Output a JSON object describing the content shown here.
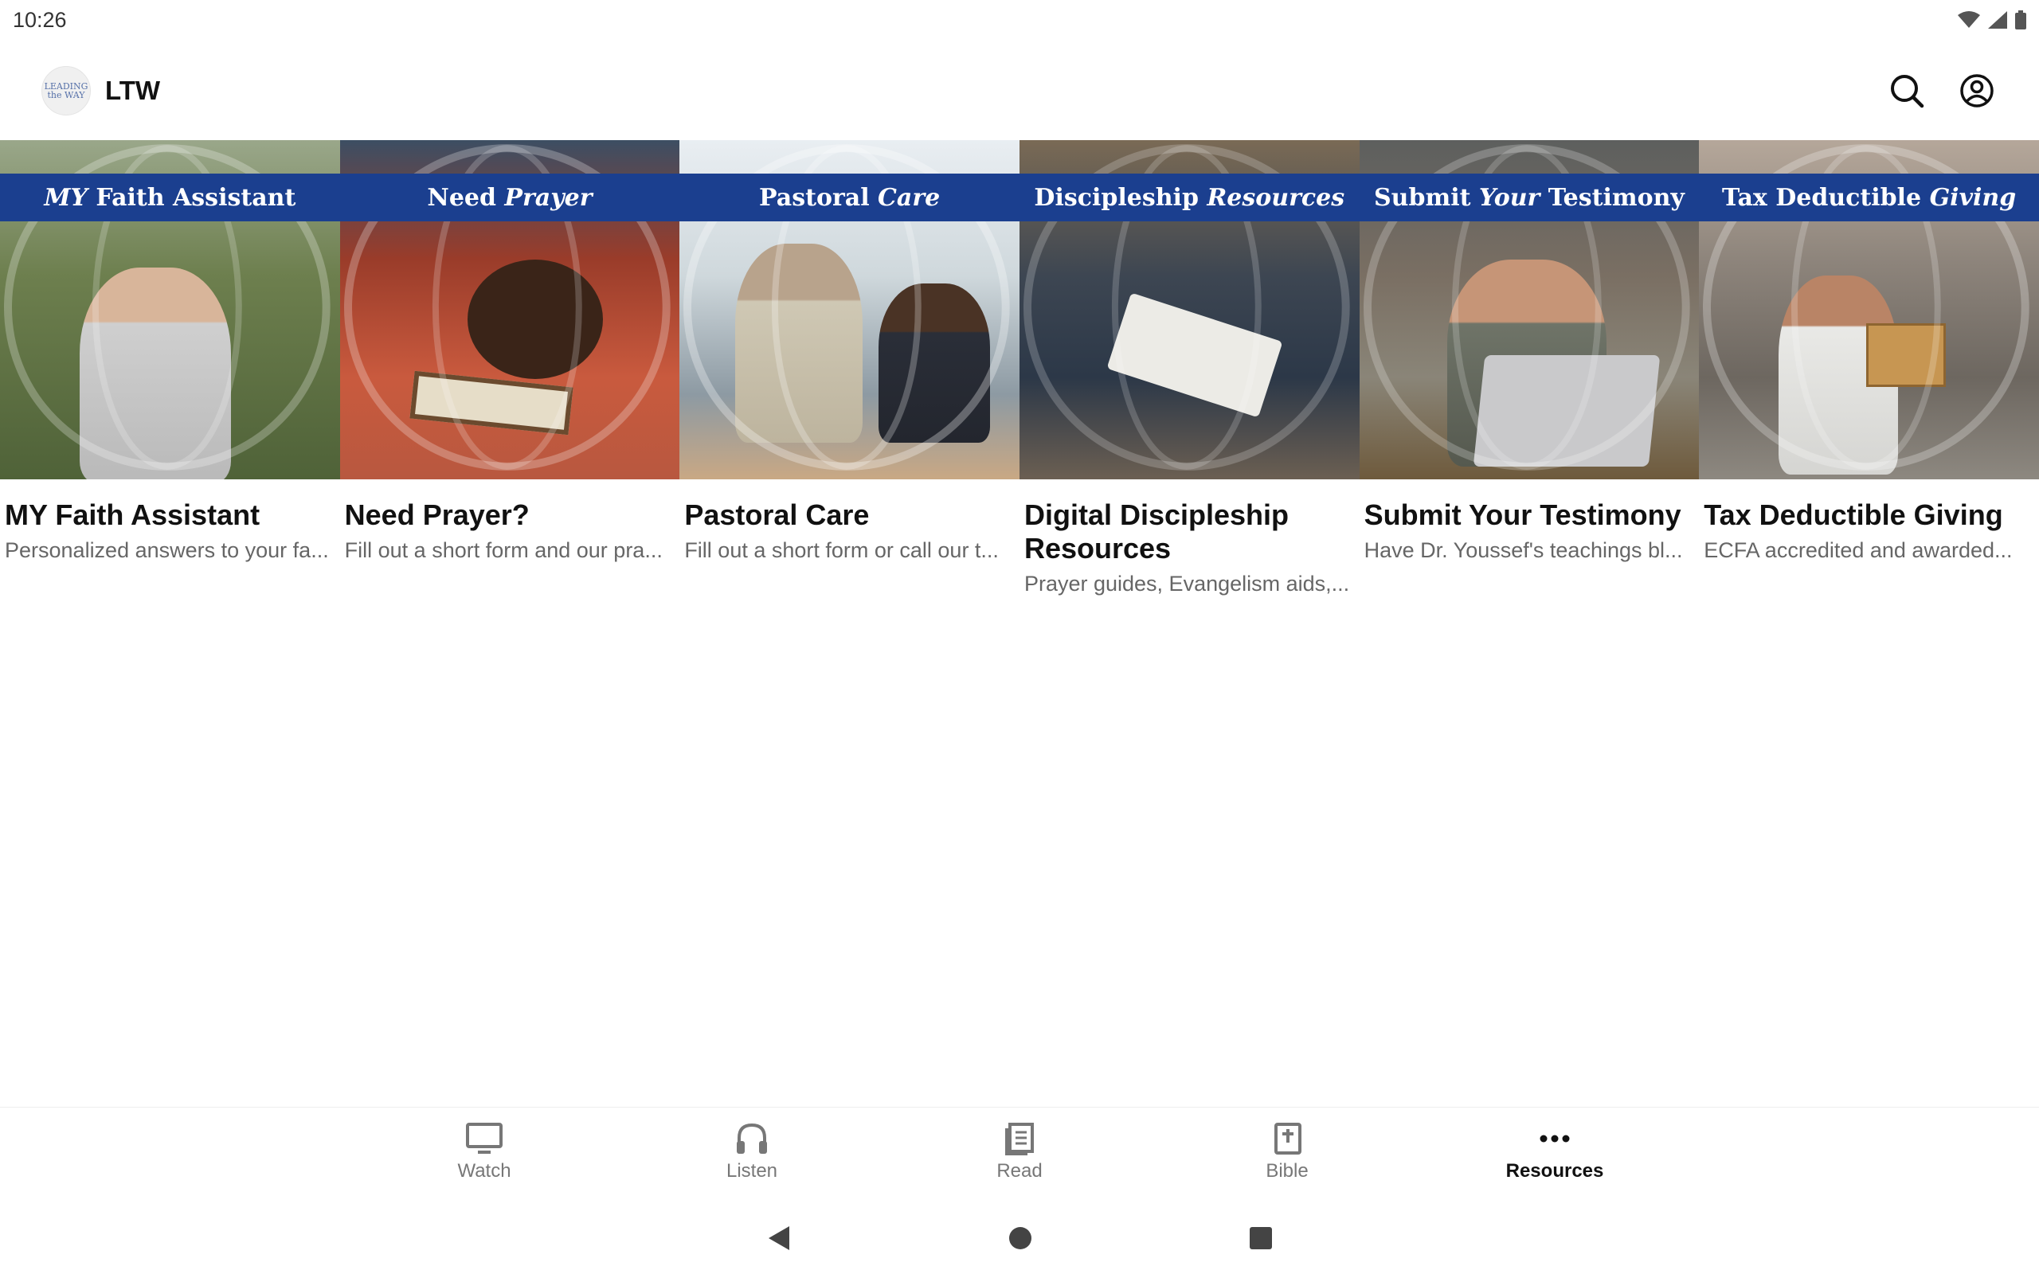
{
  "status_bar": {
    "time": "10:26",
    "icons": [
      "wifi-icon",
      "signal-icon",
      "battery-icon"
    ]
  },
  "header": {
    "logo_text": "LEADING the WAY",
    "title": "LTW",
    "actions": [
      "search-icon",
      "account-icon"
    ]
  },
  "cards": [
    {
      "banner_plain": "Faith Assistant",
      "banner_italic": "MY",
      "banner_italic_first": true,
      "title": "MY Faith Assistant",
      "subtitle": "Personalized answers to your fa..."
    },
    {
      "banner_plain": "Need",
      "banner_italic": "Prayer",
      "banner_italic_first": false,
      "title": "Need Prayer?",
      "subtitle": "Fill out a short form and our pra..."
    },
    {
      "banner_plain": "Pastoral",
      "banner_italic": "Care",
      "banner_italic_first": false,
      "title": "Pastoral Care",
      "subtitle": "Fill out a short form or call our t..."
    },
    {
      "banner_plain": "Discipleship",
      "banner_italic": "Resources",
      "banner_italic_first": false,
      "title": "Digital Discipleship Resources",
      "subtitle": "Prayer guides, Evangelism aids,..."
    },
    {
      "banner_plain_1": "Submit",
      "banner_italic": "Your",
      "banner_plain_2": "Testimony",
      "title": "Submit Your Testimony",
      "subtitle": "Have Dr. Youssef's teachings bl..."
    },
    {
      "banner_plain": "Tax Deductible",
      "banner_italic": "Giving",
      "banner_italic_first": false,
      "title": "Tax Deductible Giving",
      "subtitle": "ECFA accredited and awarded..."
    }
  ],
  "bottom_nav": [
    {
      "label": "Watch",
      "icon": "tv-icon",
      "active": false
    },
    {
      "label": "Listen",
      "icon": "headphones-icon",
      "active": false
    },
    {
      "label": "Read",
      "icon": "book-icon",
      "active": false
    },
    {
      "label": "Bible",
      "icon": "bible-icon",
      "active": false
    },
    {
      "label": "Resources",
      "icon": "more-icon",
      "active": true
    }
  ],
  "colors": {
    "banner": "#1b3f8f",
    "text_primary": "#111111",
    "text_secondary": "#666666"
  }
}
